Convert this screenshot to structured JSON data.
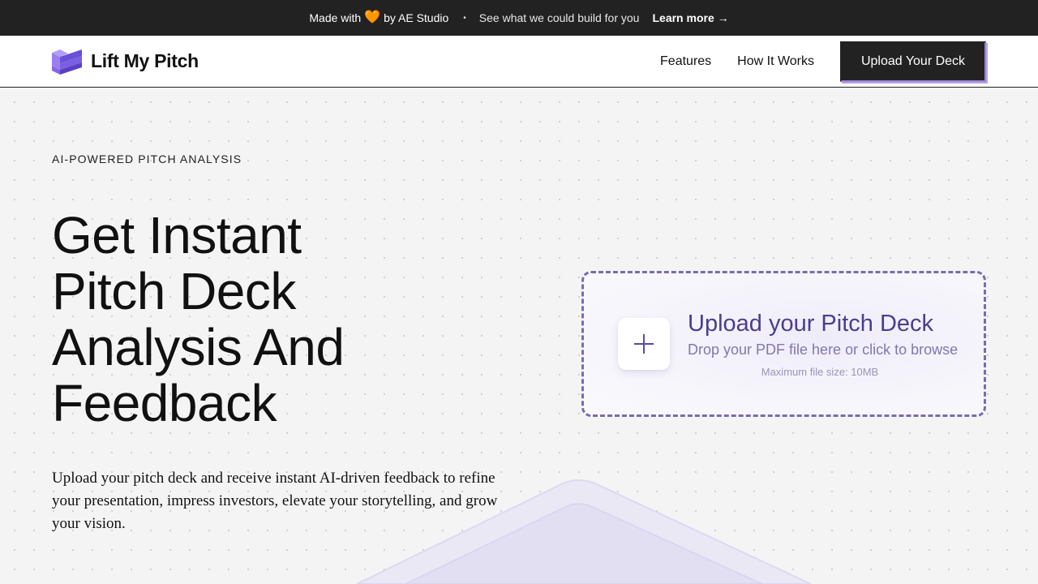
{
  "topbar": {
    "made_with": "Made with",
    "heart": "🧡",
    "by_text": "by AE Studio",
    "separator": "•",
    "see_text": "See what we could build for you",
    "learn_more": "Learn more →"
  },
  "nav": {
    "brand": "Lift My Pitch",
    "links": [
      "Features",
      "How It Works"
    ],
    "cta": "Upload Your Deck"
  },
  "hero": {
    "eyebrow": "AI-POWERED PITCH ANALYSIS",
    "headline_lines": [
      "Get Instant",
      "Pitch Deck",
      "Analysis And",
      "Feedback"
    ],
    "subtext": "Upload your pitch deck and receive instant AI-driven feedback to refine your presentation, impress investors, elevate your storytelling, and grow your vision."
  },
  "upload": {
    "title": "Upload your Pitch Deck",
    "subtitle": "Drop your PDF file here or click to browse",
    "max_size": "Maximum file size: 10MB"
  },
  "colors": {
    "topbar_bg": "#222222",
    "accent_purple": "#4b3d8f",
    "logo_purple": "#7b5fe0",
    "dashed_border": "#7a6bb3"
  },
  "icons": {
    "logo": "stacked-layers-logo-icon",
    "plus": "plus-icon",
    "arrow": "arrow-right-icon"
  }
}
